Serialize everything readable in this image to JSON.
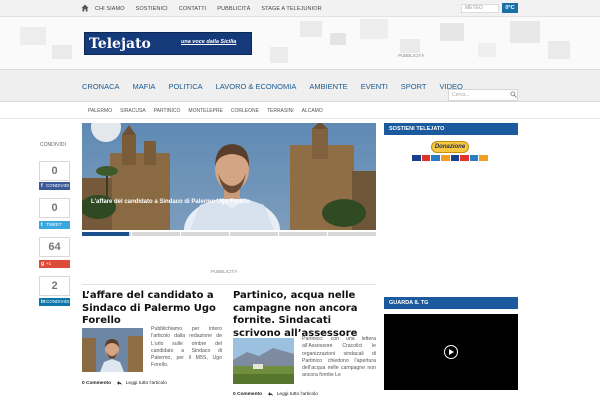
{
  "topbar": {
    "items": [
      "CHI SIAMO",
      "SOSTIENICI",
      "CONTATTI",
      "PUBBLICITÀ",
      "STAGE A TELEJUNIOR"
    ],
    "meteo_placeholder": "METEO",
    "temperature": "0°C"
  },
  "header": {
    "logo_text": "Telejato",
    "logo_tagline": "una voce dalla Sicilia",
    "ad_label": "PUBBLICITÀ"
  },
  "mainnav": {
    "items": [
      "CRONACA",
      "MAFIA",
      "POLITICA",
      "LAVORO & ECONOMIA",
      "AMBIENTE",
      "EVENTI",
      "SPORT",
      "VIDEO"
    ]
  },
  "subnav": {
    "items": [
      "PALERMO",
      "SIRACUSA",
      "PARTINICO",
      "MONTELEPRE",
      "CORLEONE",
      "TERRASINI",
      "ALCAMO"
    ],
    "search_placeholder": "Cerca..."
  },
  "share": {
    "label": "CONDIVIDI",
    "facebook_count": "0",
    "facebook_label": "CONDIVIDI",
    "twitter_count": "0",
    "twitter_label": "TWEET",
    "gplus_count": "64",
    "gplus_label": "+1",
    "linkedin_count": "2",
    "linkedin_label": "CONDIVIDI"
  },
  "slider": {
    "caption": "L’affare del candidato a Sindaco di Palermo Ugo Forello",
    "progress": 0.16
  },
  "mid_ad_label": "PUBBLICITÀ",
  "articles": [
    {
      "title": "L’affare del candidato a Sindaco di Palermo Ugo Forello",
      "excerpt": "Pubblichiamo per intero l’articolo dalla redazione de L’urlo sulle ombre del candidato a Sindaco di Palermo, per il M5S, Ugo Forello.",
      "comments": "0 Commento",
      "read_more": "Leggi tutto l'articolo"
    },
    {
      "title": "Partinico, acqua nelle campagne non ancora fornite. Sindacati scrivono all’assessore Cracolici",
      "excerpt": "Partinico: con una lettera all’Assessore Cracolici le organizzazioni sindacali di Partinico chiedono l’apertura dell’acqua nelle campagne non ancora fornite Le",
      "comments": "0 Commento",
      "read_more": "Leggi tutto l'articolo"
    }
  ],
  "sidebar": {
    "support_title": "SOSTIENI TELEJATO",
    "donate_label": "Donazione",
    "tv_title": "GUARDA IL TG"
  },
  "colors": {
    "brand_blue": "#1b5a9c",
    "nav_text": "#1a5a92",
    "logo_bg": "#153a7a"
  }
}
